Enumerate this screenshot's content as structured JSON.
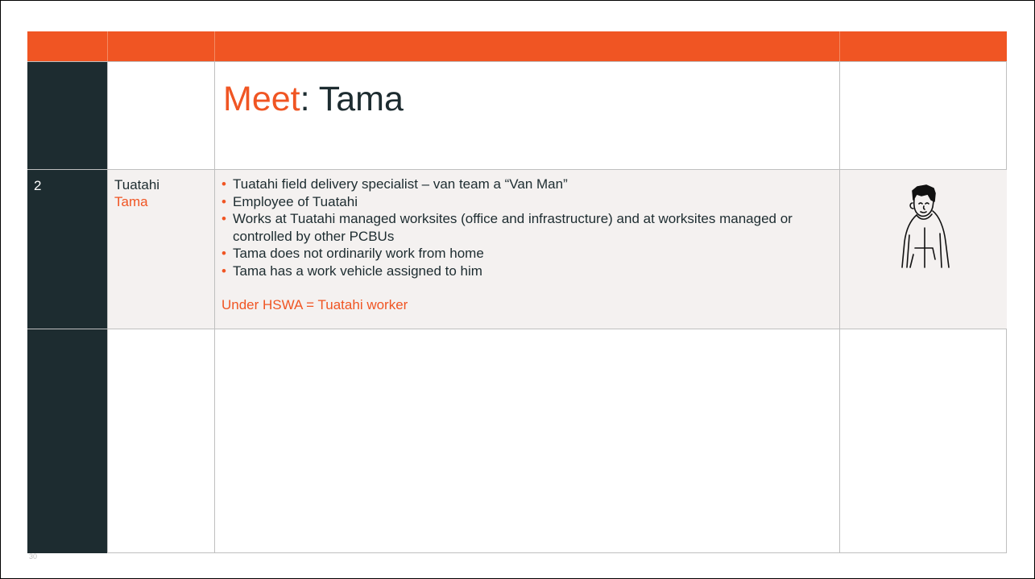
{
  "title": {
    "accent": "Meet",
    "rest": ": Tama"
  },
  "row": {
    "number": "2",
    "org": "Tuatahi",
    "name": "Tama",
    "bullets": [
      "Tuatahi field delivery specialist – van team a “Van Man”",
      "Employee of Tuatahi",
      "Works at Tuatahi managed worksites (office and infrastructure) and at worksites managed or controlled by other PCBUs",
      "Tama does not ordinarily work from home",
      "Tama has a work vehicle assigned to him"
    ],
    "conclusion": "Under HSWA = Tuatahi worker"
  },
  "page_number": "30",
  "avatar_icon": "person-hoodie-illustration",
  "colors": {
    "accent": "#f05523",
    "dark": "#1d2c30",
    "shade": "#f4f1f0"
  }
}
